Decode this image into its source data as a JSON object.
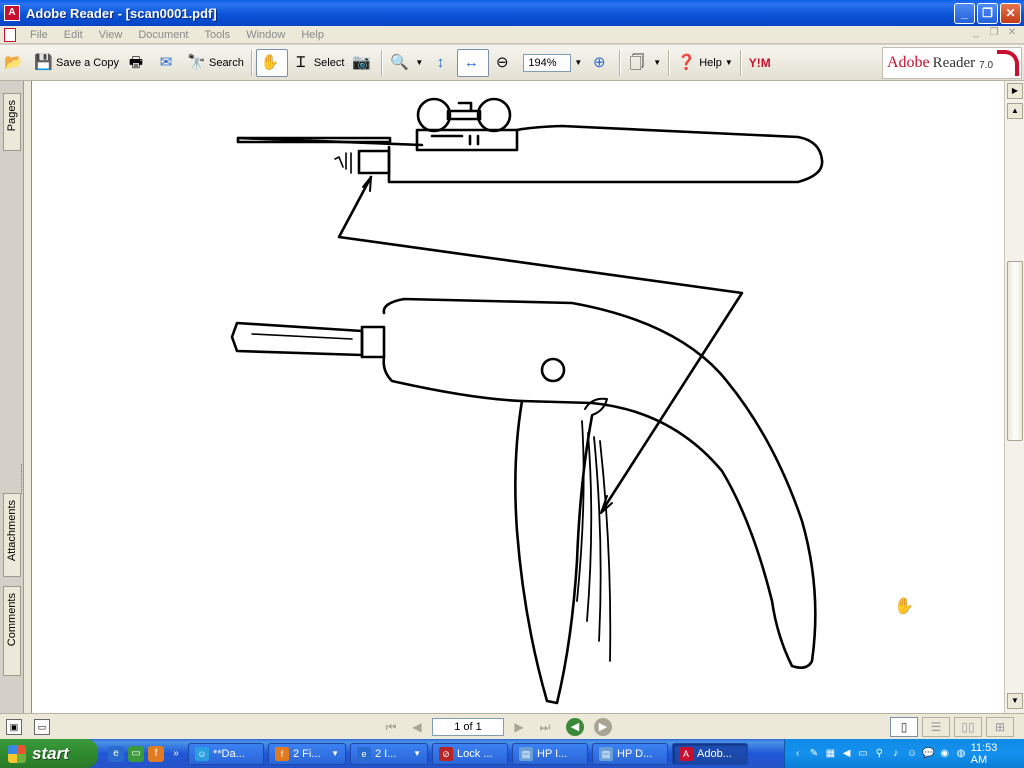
{
  "window": {
    "title": "Adobe Reader - [scan0001.pdf]"
  },
  "menu": {
    "items": [
      "File",
      "Edit",
      "View",
      "Document",
      "Tools",
      "Window",
      "Help"
    ]
  },
  "toolbar": {
    "save_copy": "Save a Copy",
    "search": "Search",
    "select": "Select",
    "zoom_value": "194%",
    "help": "Help",
    "yahoo": "Y!M"
  },
  "brand": {
    "adobe": "Adobe",
    "reader": "Reader",
    "version": "7.0"
  },
  "sidetabs": {
    "pages": "Pages",
    "attachments": "Attachments",
    "comments": "Comments"
  },
  "statusbar": {
    "page_indicator": "1 of 1"
  },
  "taskbar": {
    "start": "start",
    "tasks": [
      "**Da...",
      "2 Fi...",
      "2 I...",
      "Lock ...",
      "HP I...",
      "HP D...",
      "Adob..."
    ],
    "clock": "11:53 AM"
  },
  "colors": {
    "titlebar": "#0b54d9",
    "taskbar": "#2453c8",
    "start": "#2f8a2f",
    "adobe_red": "#c8102e"
  }
}
